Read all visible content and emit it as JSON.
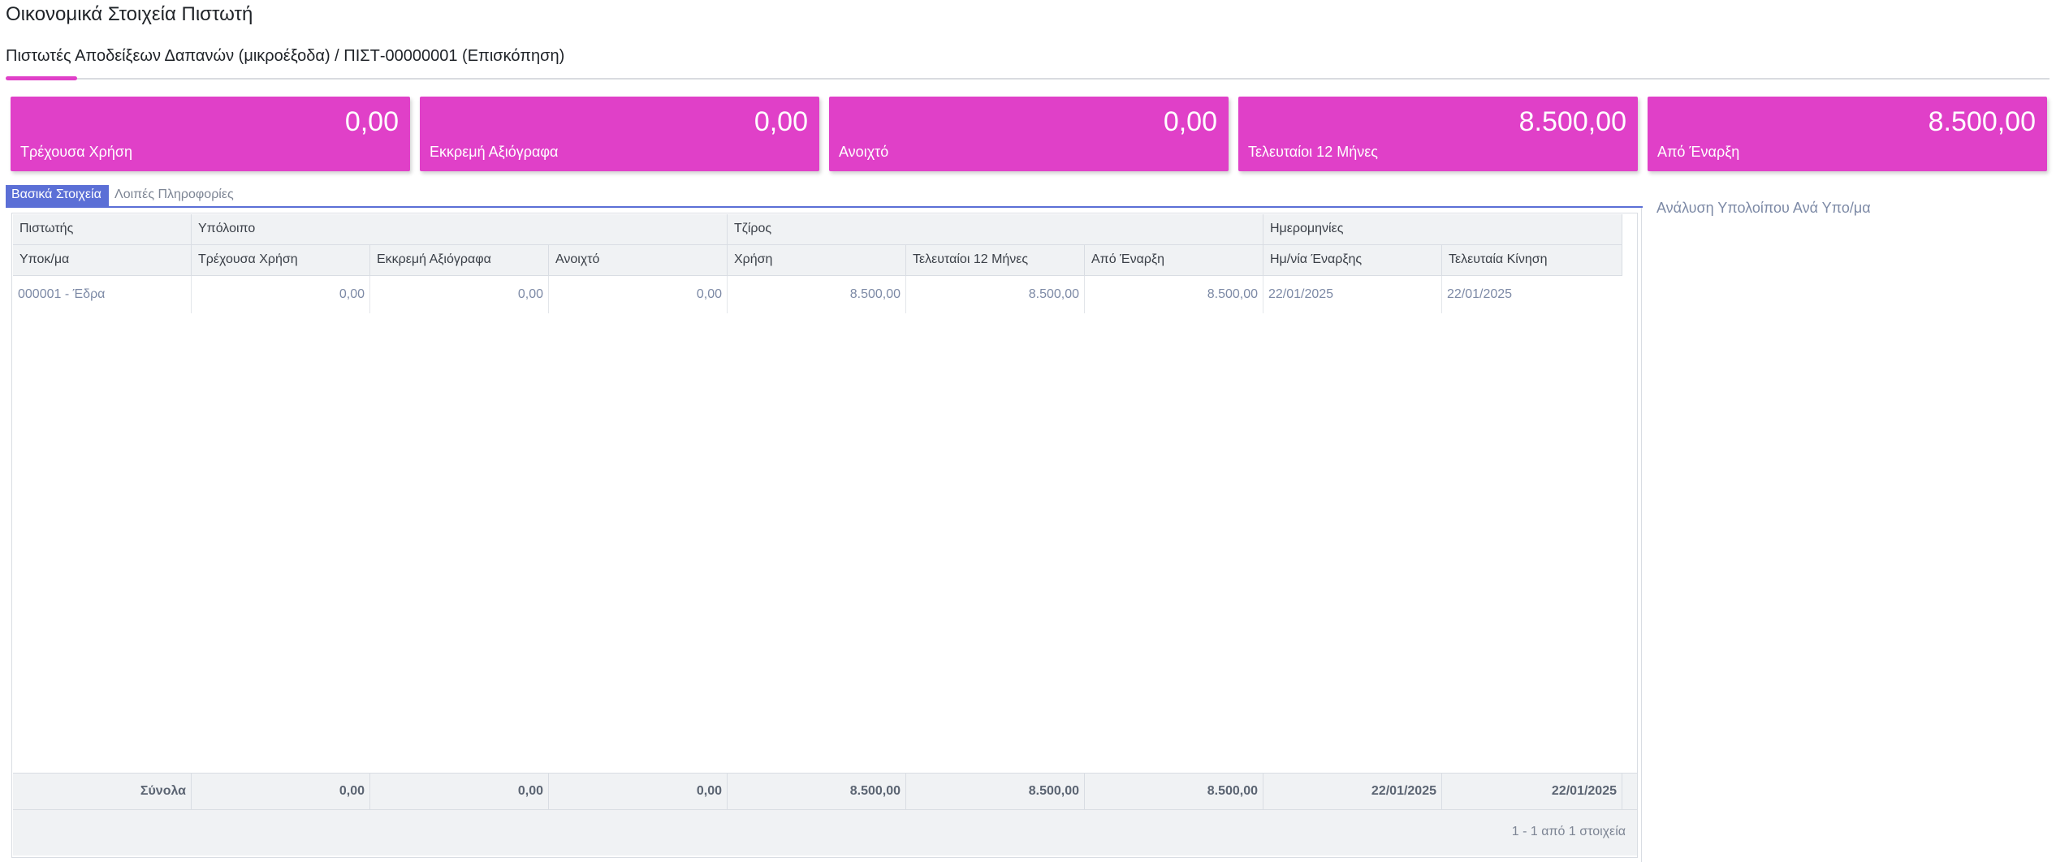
{
  "page": {
    "title": "Οικονομικά Στοιχεία Πιστωτή",
    "subtitle": "Πιστωτές Αποδείξεων Δαπανών (μικροέξοδα) / ΠΙΣΤ-00000001 (Επισκόπηση)",
    "accent_color": "#e040c8"
  },
  "kpis": [
    {
      "value": "0,00",
      "label": "Τρέχουσα Χρήση"
    },
    {
      "value": "0,00",
      "label": "Εκκρεμή Αξιόγραφα"
    },
    {
      "value": "0,00",
      "label": "Ανοιχτό"
    },
    {
      "value": "8.500,00",
      "label": "Τελευταίοι 12 Μήνες"
    },
    {
      "value": "8.500,00",
      "label": "Από Έναρξη"
    }
  ],
  "tabs": {
    "active": "Βασικά Στοιχεία",
    "other": "Λοιπές Πληροφορίες",
    "active_color": "#5b6fd6"
  },
  "side_panel": {
    "link": "Ανάλυση Υπολοίπου Ανά Υπο/μα"
  },
  "grid": {
    "group_headers": [
      "Πιστωτής",
      "Υπόλοιπο",
      "Τζίρος",
      "Ημερομηνίες"
    ],
    "columns": [
      "Υποκ/μα",
      "Τρέχουσα Χρήση",
      "Εκκρεμή Αξιόγραφα",
      "Ανοιχτό",
      "Χρήση",
      "Τελευταίοι 12 Μήνες",
      "Από Έναρξη",
      "Ημ/νία Έναρξης",
      "Τελευταία Κίνηση"
    ],
    "rows": [
      [
        "000001 - Έδρα",
        "0,00",
        "0,00",
        "0,00",
        "8.500,00",
        "8.500,00",
        "8.500,00",
        "22/01/2025",
        "22/01/2025"
      ]
    ],
    "totals": [
      "Σύνολα",
      "0,00",
      "0,00",
      "0,00",
      "8.500,00",
      "8.500,00",
      "8.500,00",
      "22/01/2025",
      "22/01/2025"
    ],
    "pager": "1 - 1 από 1 στοιχεία"
  }
}
